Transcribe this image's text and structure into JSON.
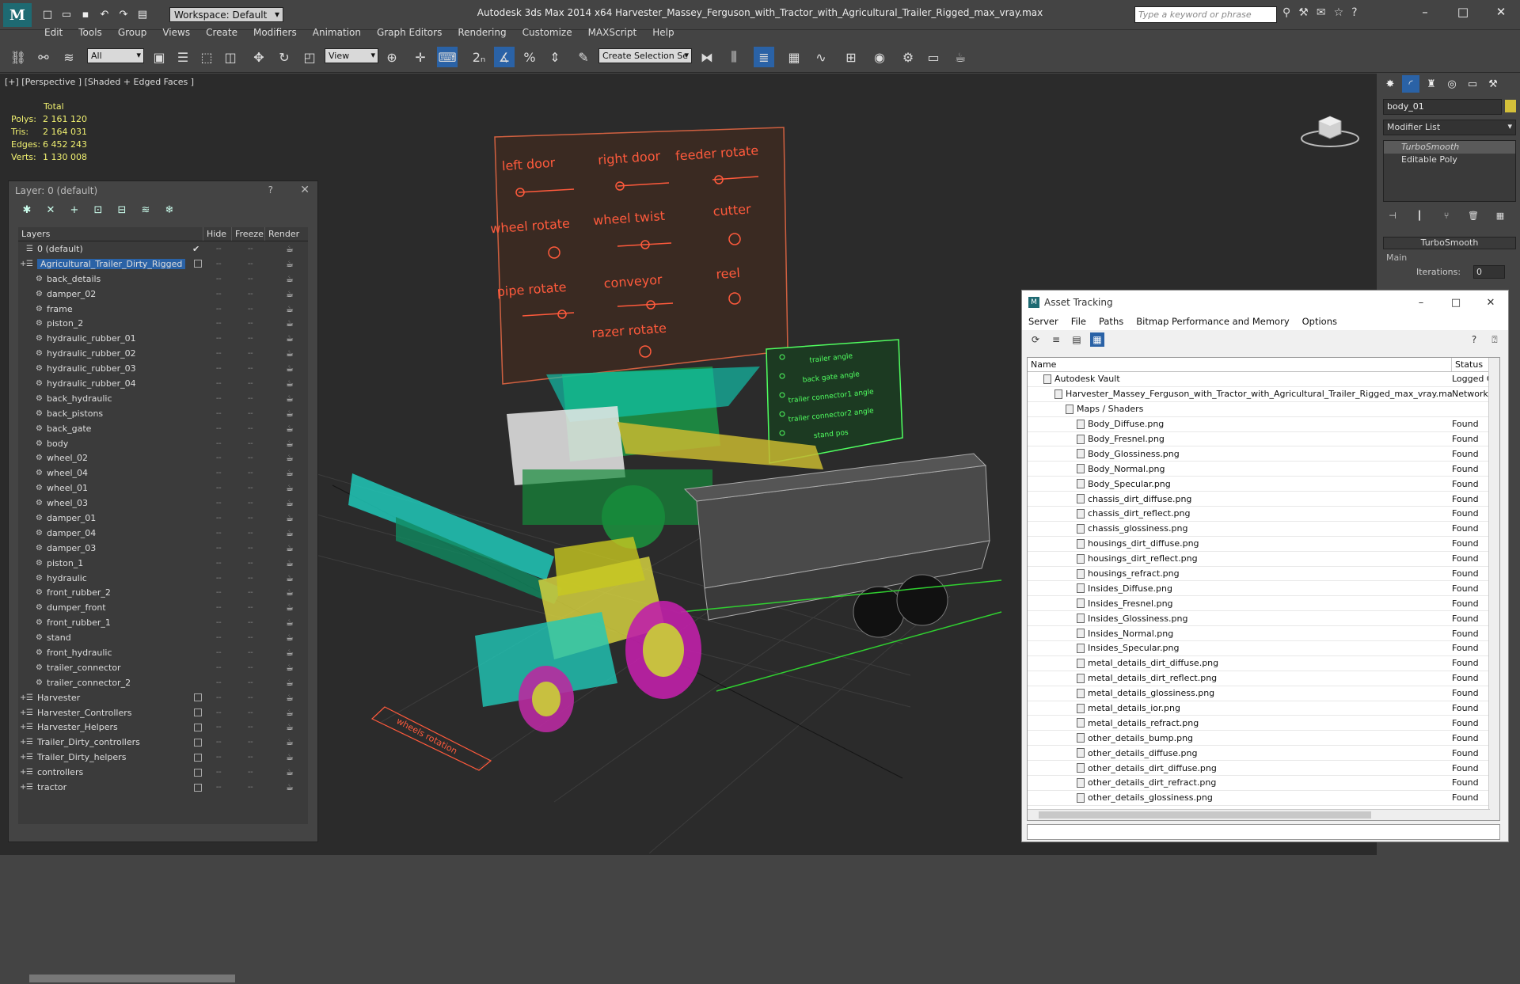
{
  "app": {
    "workspace": "Workspace: Default",
    "title": "Autodesk 3ds Max  2014 x64       Harvester_Massey_Ferguson_with_Tractor_with_Agricultural_Trailer_Rigged_max_vray.max",
    "search_placeholder": "Type a keyword or phrase"
  },
  "menu": [
    "Edit",
    "Tools",
    "Group",
    "Views",
    "Create",
    "Modifiers",
    "Animation",
    "Graph Editors",
    "Rendering",
    "Customize",
    "MAXScript",
    "Help"
  ],
  "toolbar": {
    "filter": "All",
    "refcoord": "View",
    "selset": "Create Selection Se"
  },
  "viewport": {
    "label": "[+] [Perspective ] [Shaded + Edged Faces ]",
    "stats": {
      "header": "Total",
      "rows": [
        {
          "k": "Polys:",
          "v": "2 161 120"
        },
        {
          "k": "Tris:",
          "v": "2 164 031"
        },
        {
          "k": "Edges:",
          "v": "6 452 243"
        },
        {
          "k": "Verts:",
          "v": "1 130 008"
        }
      ]
    },
    "controls": [
      "left door",
      "right door",
      "feeder rotate",
      "wheel rotate",
      "wheel twist",
      "cutter",
      "pipe rotate",
      "conveyor",
      "reel",
      "razer rotate"
    ],
    "trailer_controls": [
      "trailer angle",
      "back gate angle",
      "trailer connector1 angle",
      "trailer connector2 angle",
      "stand pos"
    ],
    "ground_label": "wheels rotation"
  },
  "cmd": {
    "object": "body_01",
    "modifier_list": "Modifier List",
    "stack": [
      "TurboSmooth",
      "Editable Poly"
    ],
    "rollout": "TurboSmooth",
    "main": "Main",
    "iter_label": "Iterations:",
    "iter_value": "0"
  },
  "layers": {
    "title": "Layer: 0 (default)",
    "cols": [
      "Layers",
      "Hide",
      "Freeze",
      "Render"
    ],
    "rows": [
      {
        "name": "0 (default)",
        "level": 0,
        "check": true
      },
      {
        "name": "Agricultural_Trailer_Dirty_Rigged",
        "level": 0,
        "sel": true,
        "box": true
      },
      {
        "name": "back_details",
        "level": 1
      },
      {
        "name": "damper_02",
        "level": 1
      },
      {
        "name": "frame",
        "level": 1
      },
      {
        "name": "piston_2",
        "level": 1
      },
      {
        "name": "hydraulic_rubber_01",
        "level": 1
      },
      {
        "name": "hydraulic_rubber_02",
        "level": 1
      },
      {
        "name": "hydraulic_rubber_03",
        "level": 1
      },
      {
        "name": "hydraulic_rubber_04",
        "level": 1
      },
      {
        "name": "back_hydraulic",
        "level": 1
      },
      {
        "name": "back_pistons",
        "level": 1
      },
      {
        "name": "back_gate",
        "level": 1
      },
      {
        "name": "body",
        "level": 1
      },
      {
        "name": "wheel_02",
        "level": 1
      },
      {
        "name": "wheel_04",
        "level": 1
      },
      {
        "name": "wheel_01",
        "level": 1
      },
      {
        "name": "wheel_03",
        "level": 1
      },
      {
        "name": "damper_01",
        "level": 1
      },
      {
        "name": "damper_04",
        "level": 1
      },
      {
        "name": "damper_03",
        "level": 1
      },
      {
        "name": "piston_1",
        "level": 1
      },
      {
        "name": "hydraulic",
        "level": 1
      },
      {
        "name": "front_rubber_2",
        "level": 1
      },
      {
        "name": "dumper_front",
        "level": 1
      },
      {
        "name": "front_rubber_1",
        "level": 1
      },
      {
        "name": "stand",
        "level": 1
      },
      {
        "name": "front_hydraulic",
        "level": 1
      },
      {
        "name": "trailer_connector",
        "level": 1
      },
      {
        "name": "trailer_connector_2",
        "level": 1
      },
      {
        "name": "Harvester",
        "level": 0,
        "box": true
      },
      {
        "name": "Harvester_Controllers",
        "level": 0,
        "box": true
      },
      {
        "name": "Harvester_Helpers",
        "level": 0,
        "box": true
      },
      {
        "name": "Trailer_Dirty_controllers",
        "level": 0,
        "box": true
      },
      {
        "name": "Trailer_Dirty_helpers",
        "level": 0,
        "box": true
      },
      {
        "name": "controllers",
        "level": 0,
        "box": true
      },
      {
        "name": "tractor",
        "level": 0,
        "box": true
      }
    ]
  },
  "assets": {
    "title": "Asset Tracking",
    "menu": [
      "Server",
      "File",
      "Paths",
      "Bitmap Performance and Memory",
      "Options"
    ],
    "cols": [
      "Name",
      "Status"
    ],
    "rows": [
      {
        "name": "Autodesk Vault",
        "status": "Logged O",
        "level": 1
      },
      {
        "name": "Harvester_Massey_Ferguson_with_Tractor_with_Agricultural_Trailer_Rigged_max_vray.max",
        "status": "Network F",
        "level": 2
      },
      {
        "name": "Maps / Shaders",
        "status": "",
        "level": 3
      },
      {
        "name": "Body_Diffuse.png",
        "status": "Found",
        "level": 4
      },
      {
        "name": "Body_Fresnel.png",
        "status": "Found",
        "level": 4
      },
      {
        "name": "Body_Glossiness.png",
        "status": "Found",
        "level": 4
      },
      {
        "name": "Body_Normal.png",
        "status": "Found",
        "level": 4
      },
      {
        "name": "Body_Specular.png",
        "status": "Found",
        "level": 4
      },
      {
        "name": "chassis_dirt_diffuse.png",
        "status": "Found",
        "level": 4
      },
      {
        "name": "chassis_dirt_reflect.png",
        "status": "Found",
        "level": 4
      },
      {
        "name": "chassis_glossiness.png",
        "status": "Found",
        "level": 4
      },
      {
        "name": "housings_dirt_diffuse.png",
        "status": "Found",
        "level": 4
      },
      {
        "name": "housings_dirt_reflect.png",
        "status": "Found",
        "level": 4
      },
      {
        "name": "housings_refract.png",
        "status": "Found",
        "level": 4
      },
      {
        "name": "Insides_Diffuse.png",
        "status": "Found",
        "level": 4
      },
      {
        "name": "Insides_Fresnel.png",
        "status": "Found",
        "level": 4
      },
      {
        "name": "Insides_Glossiness.png",
        "status": "Found",
        "level": 4
      },
      {
        "name": "Insides_Normal.png",
        "status": "Found",
        "level": 4
      },
      {
        "name": "Insides_Specular.png",
        "status": "Found",
        "level": 4
      },
      {
        "name": "metal_details_dirt_diffuse.png",
        "status": "Found",
        "level": 4
      },
      {
        "name": "metal_details_dirt_reflect.png",
        "status": "Found",
        "level": 4
      },
      {
        "name": "metal_details_glossiness.png",
        "status": "Found",
        "level": 4
      },
      {
        "name": "metal_details_ior.png",
        "status": "Found",
        "level": 4
      },
      {
        "name": "metal_details_refract.png",
        "status": "Found",
        "level": 4
      },
      {
        "name": "other_details_bump.png",
        "status": "Found",
        "level": 4
      },
      {
        "name": "other_details_diffuse.png",
        "status": "Found",
        "level": 4
      },
      {
        "name": "other_details_dirt_diffuse.png",
        "status": "Found",
        "level": 4
      },
      {
        "name": "other_details_dirt_refract.png",
        "status": "Found",
        "level": 4
      },
      {
        "name": "other_details_glossiness.png",
        "status": "Found",
        "level": 4
      }
    ]
  }
}
